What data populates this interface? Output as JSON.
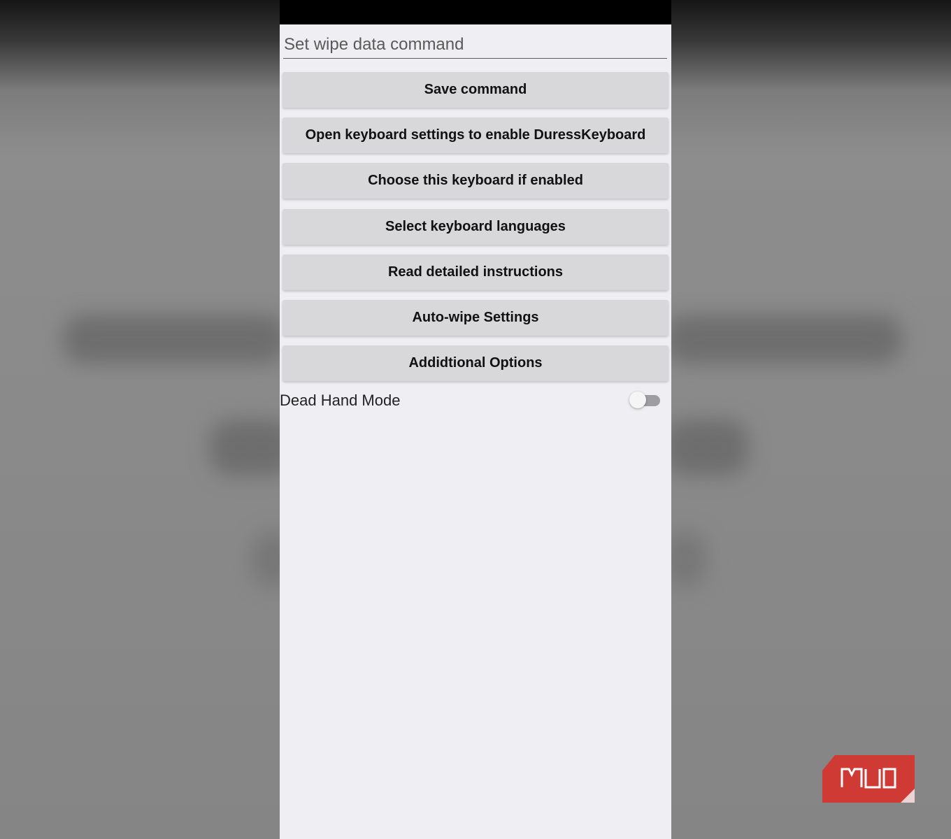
{
  "input": {
    "placeholder": "Set wipe data command"
  },
  "buttons": [
    {
      "label": "Save command"
    },
    {
      "label": "Open keyboard settings to enable DuressKeyboard"
    },
    {
      "label": "Choose this keyboard if enabled"
    },
    {
      "label": "Select keyboard languages"
    },
    {
      "label": "Read detailed instructions"
    },
    {
      "label": "Auto-wipe Settings"
    },
    {
      "label": "Addidtional Options"
    }
  ],
  "dead_hand": {
    "label": "Dead Hand Mode",
    "enabled": false
  },
  "watermark": {
    "text": "MUO",
    "color": "#d03a34"
  }
}
